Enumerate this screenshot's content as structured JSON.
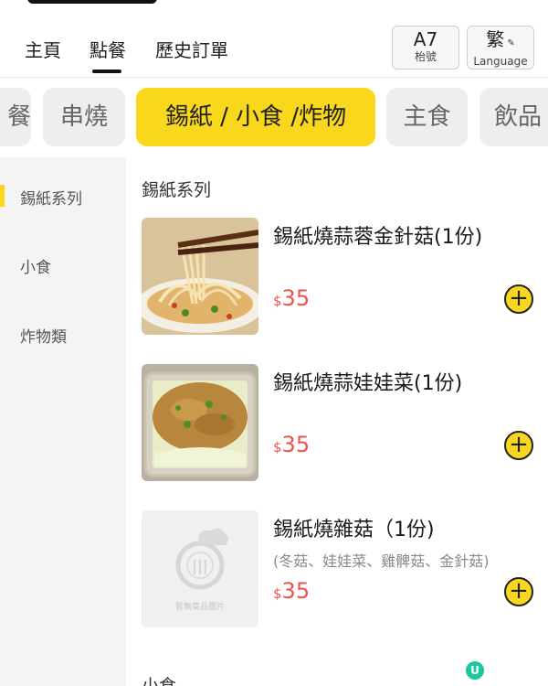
{
  "nav": {
    "links": [
      "主頁",
      "點餐",
      "歷史訂單"
    ],
    "table": {
      "value": "A7",
      "label": "枱號"
    },
    "language": {
      "value": "繁",
      "label": "Language"
    }
  },
  "categories": [
    "餐",
    "串燒",
    "錫紙 / 小食 /炸物",
    "主食",
    "飲品"
  ],
  "active_category": "錫紙 / 小食 /炸物",
  "sidebar": {
    "items": [
      "錫紙系列",
      "小食",
      "炸物類"
    ],
    "active": "錫紙系列"
  },
  "sections": [
    {
      "title": "錫紙系列",
      "items": [
        {
          "name": "錫紙燒蒜蓉金針菇(1份)",
          "desc": "",
          "currency": "$",
          "price": "35",
          "image": "enoki-mushroom-photo"
        },
        {
          "name": "錫紙燒蒜娃娃菜(1份)",
          "desc": "",
          "currency": "$",
          "price": "35",
          "image": "baby-cabbage-photo"
        },
        {
          "name": "錫紙燒雜菇（1份)",
          "desc": "(冬菇、娃娃菜、雞髀菇、金針菇)",
          "currency": "$",
          "price": "35",
          "image": "placeholder",
          "placeholder_text": "暫無菜品圖片"
        }
      ]
    },
    {
      "title": "小食"
    }
  ],
  "add_label": "+",
  "floating_badge": "U",
  "colors": {
    "accent": "#f9d71c",
    "price": "#e8574f",
    "sidebar_bg": "#f4f4f4",
    "tab_bg": "#eeeeee",
    "badge": "#21c6a0"
  }
}
